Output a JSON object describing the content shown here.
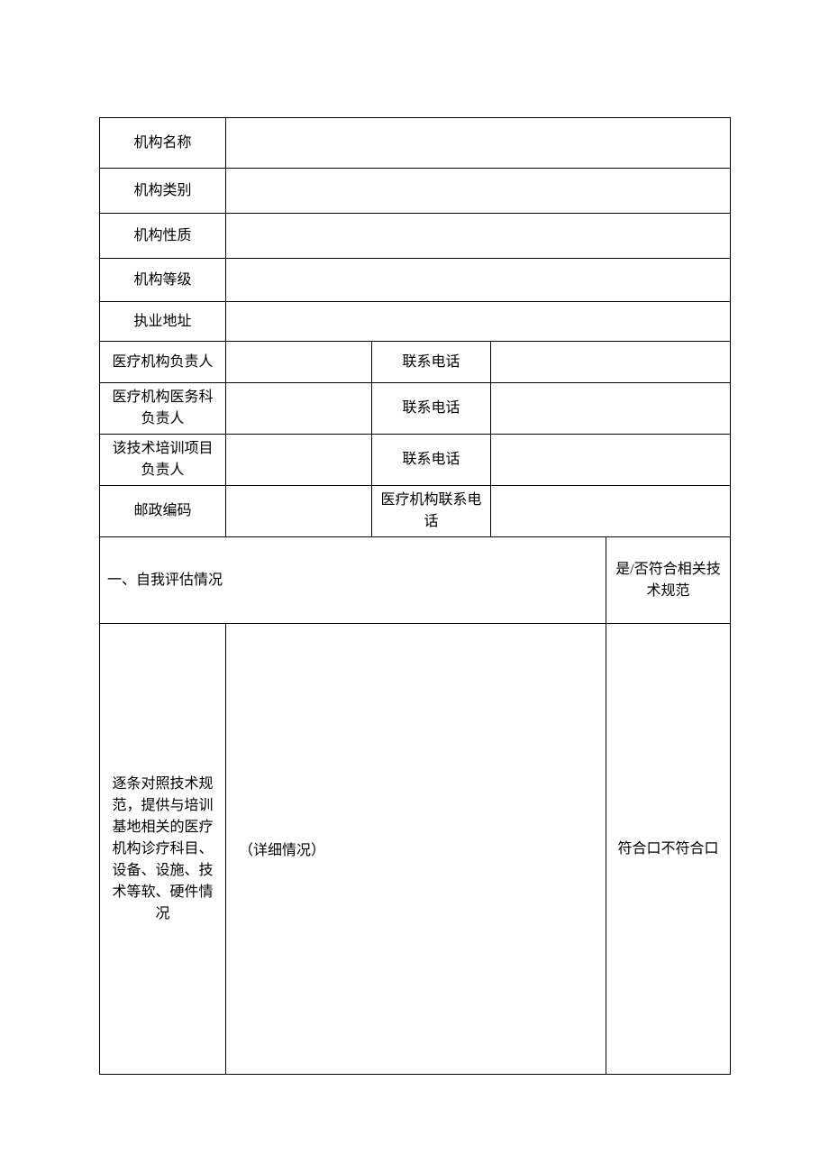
{
  "rows": {
    "org_name": {
      "label": "机构名称",
      "value": ""
    },
    "org_category": {
      "label": "机构类别",
      "value": ""
    },
    "org_nature": {
      "label": "机构性质",
      "value": ""
    },
    "org_grade": {
      "label": "机构等级",
      "value": ""
    },
    "practice_address": {
      "label": "执业地址",
      "value": ""
    },
    "med_head": {
      "label": "医疗机构负责人",
      "value": "",
      "phone_label": "联系电话",
      "phone": ""
    },
    "med_affairs_head": {
      "label": "医疗机构医务科负责人",
      "value": "",
      "phone_label": "联系电话",
      "phone": ""
    },
    "tech_training_head": {
      "label": "该技术培训项目负责人",
      "value": "",
      "phone_label": "联系电话",
      "phone": ""
    },
    "postal": {
      "label": "邮政编码",
      "value": "",
      "org_phone_label": "医疗机构联系电话",
      "org_phone": ""
    }
  },
  "section": {
    "title": "一、自我评估情况",
    "right_header": "是/否符合相关技术规范",
    "item_label": "逐条对照技术规范，提供与培训基地相关的医疗机构诊疗科目、设备、设施、技术等软、硬件情况",
    "detail_placeholder": "（详细情况）",
    "choice_text": "符合口不符合口"
  }
}
